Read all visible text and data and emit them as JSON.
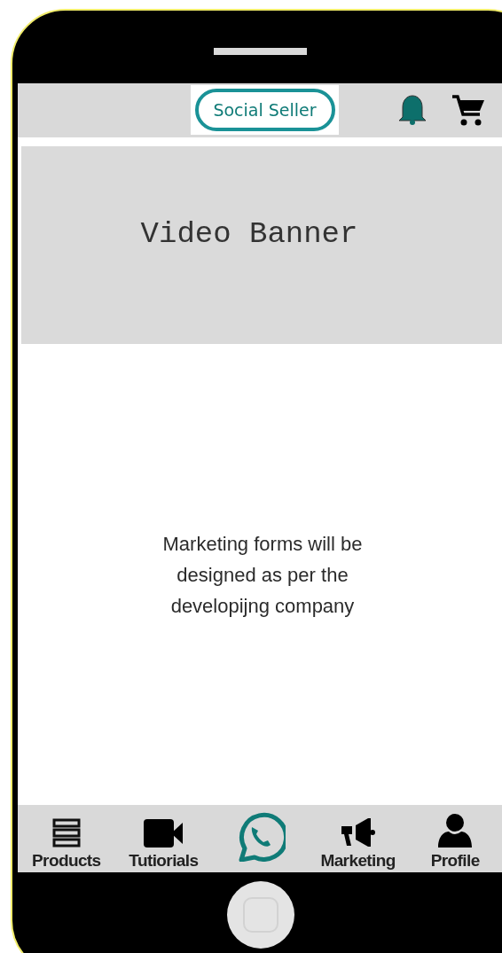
{
  "header": {
    "logo": "Social Seller"
  },
  "banner": {
    "title": "Video Banner"
  },
  "content": {
    "message": "Marketing forms will be designed as per the developijng company"
  },
  "bottom_nav": [
    {
      "kind": "tab",
      "label": "Products"
    },
    {
      "kind": "tab",
      "label": "Tutiorials"
    },
    {
      "kind": "fab"
    },
    {
      "kind": "tab",
      "label": "Marketing"
    },
    {
      "kind": "tab",
      "label": "Profile"
    }
  ]
}
